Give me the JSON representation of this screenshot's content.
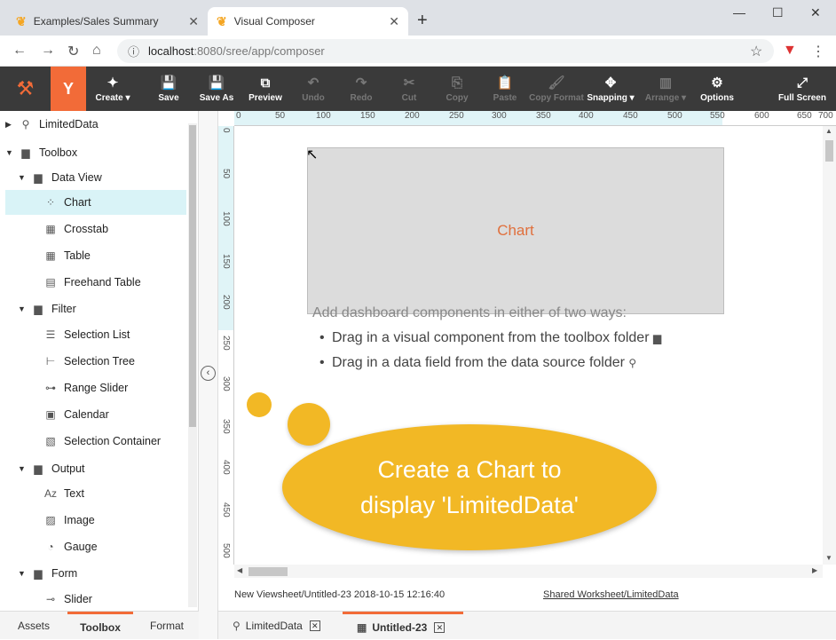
{
  "browser": {
    "tabs": [
      {
        "title": "Examples/Sales Summary",
        "close": "✕"
      },
      {
        "title": "Visual Composer",
        "close": "✕"
      }
    ],
    "new_tab": "+",
    "url_host": "localhost",
    "url_path": ":8080/sree/app/composer"
  },
  "toolbar": {
    "buttons": [
      {
        "label": "Create ▾",
        "icon": "✦"
      },
      {
        "label": "Save",
        "icon": "💾"
      },
      {
        "label": "Save As",
        "icon": "💾"
      },
      {
        "label": "Preview",
        "icon": "⧉"
      },
      {
        "label": "Undo",
        "icon": "↶"
      },
      {
        "label": "Redo",
        "icon": "↷"
      },
      {
        "label": "Cut",
        "icon": "✂"
      },
      {
        "label": "Copy",
        "icon": "⎘"
      },
      {
        "label": "Paste",
        "icon": "📋"
      },
      {
        "label": "Copy Format",
        "icon": "🖌"
      },
      {
        "label": "Snapping ▾",
        "icon": "✥"
      },
      {
        "label": "Arrange ▾",
        "icon": "▥"
      },
      {
        "label": "Options",
        "icon": "⚙"
      },
      {
        "label": "Full Screen",
        "icon": "⤢"
      }
    ]
  },
  "tree": {
    "items": [
      {
        "label": "LimitedData"
      },
      {
        "label": "Toolbox"
      },
      {
        "label": "Data View"
      },
      {
        "label": "Chart"
      },
      {
        "label": "Crosstab"
      },
      {
        "label": "Table"
      },
      {
        "label": "Freehand Table"
      },
      {
        "label": "Filter"
      },
      {
        "label": "Selection List"
      },
      {
        "label": "Selection Tree"
      },
      {
        "label": "Range Slider"
      },
      {
        "label": "Calendar"
      },
      {
        "label": "Selection Container"
      },
      {
        "label": "Output"
      },
      {
        "label": "Text"
      },
      {
        "label": "Image"
      },
      {
        "label": "Gauge"
      },
      {
        "label": "Form"
      },
      {
        "label": "Slider"
      }
    ]
  },
  "left_tabs": [
    "Assets",
    "Toolbox",
    "Format"
  ],
  "ruler": {
    "h_ticks": [
      "0",
      "50",
      "100",
      "150",
      "200",
      "250",
      "300",
      "350",
      "400",
      "450",
      "500",
      "550",
      "600",
      "650",
      "700"
    ],
    "v_ticks": [
      "0",
      "50",
      "100",
      "150",
      "200",
      "250",
      "300",
      "350",
      "400",
      "450",
      "500"
    ]
  },
  "canvas": {
    "chart_label": "Chart",
    "hint_heading": "Add dashboard components in either of two ways:",
    "hint_items": [
      "Drag in a visual component from the toolbox folder",
      "Drag in a data field from the data source folder"
    ],
    "callout_line1": "Create a Chart to",
    "callout_line2": "display 'LimitedData'"
  },
  "status": {
    "left": "New Viewsheet/Untitled-23 2018-10-15 12:16:40",
    "right": "Shared Worksheet/LimitedData"
  },
  "doc_tabs": [
    {
      "label": "LimitedData"
    },
    {
      "label": "Untitled-23"
    }
  ]
}
